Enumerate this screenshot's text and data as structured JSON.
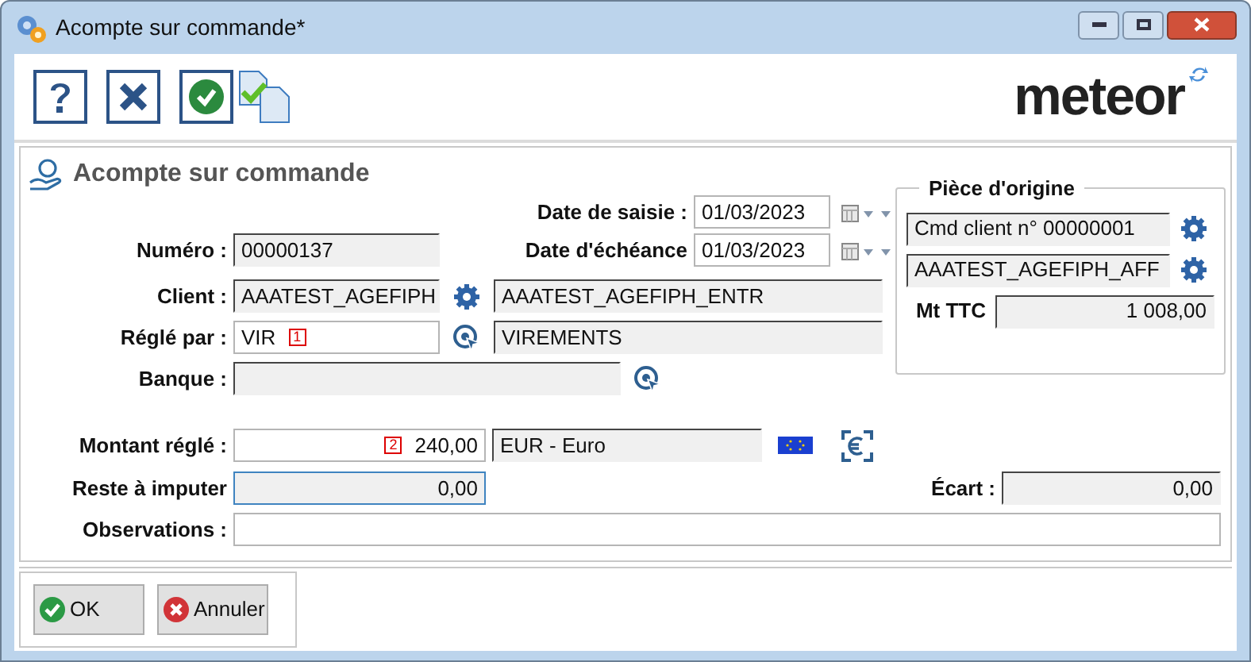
{
  "window": {
    "title": "Acompte sur commande*"
  },
  "logo": "meteor",
  "form": {
    "title": "Acompte sur commande",
    "date_saisie": {
      "label": "Date de saisie :",
      "value": "01/03/2023"
    },
    "numero": {
      "label": "Numéro :",
      "value": "00000137",
      "readonly": true
    },
    "date_echeance": {
      "label": "Date d'échéance",
      "value": "01/03/2023"
    },
    "client": {
      "label": "Client :",
      "code": "AAATEST_AGEFIPH",
      "name": "AAATEST_AGEFIPH_ENTR",
      "readonly": true
    },
    "regle_par": {
      "label": "Réglé par :",
      "code": "VIR",
      "badge": "1",
      "name": "VIREMENTS",
      "readonly": false
    },
    "banque": {
      "label": "Banque :",
      "readonly": true
    },
    "origine": {
      "title": "Pièce d'origine",
      "refs": [
        "Cmd client n° 00000001",
        "AAATEST_AGEFIPH_AFF"
      ],
      "total_label": "Mt TTC",
      "total": "1 008,00"
    },
    "montant": {
      "label": "Montant réglé :",
      "badge": "2",
      "value": "240,00",
      "currency": "EUR - Euro",
      "readonly": false
    },
    "reste": {
      "label": "Reste à imputer",
      "value": "0,00",
      "focused": true
    },
    "ecart": {
      "label": "Écart :",
      "value": "0,00"
    },
    "observations": {
      "label": "Observations :",
      "readonly": false
    }
  },
  "buttons": [
    {
      "kind": "ok",
      "label": "OK"
    },
    {
      "kind": "cancel",
      "label": "Annuler"
    }
  ]
}
